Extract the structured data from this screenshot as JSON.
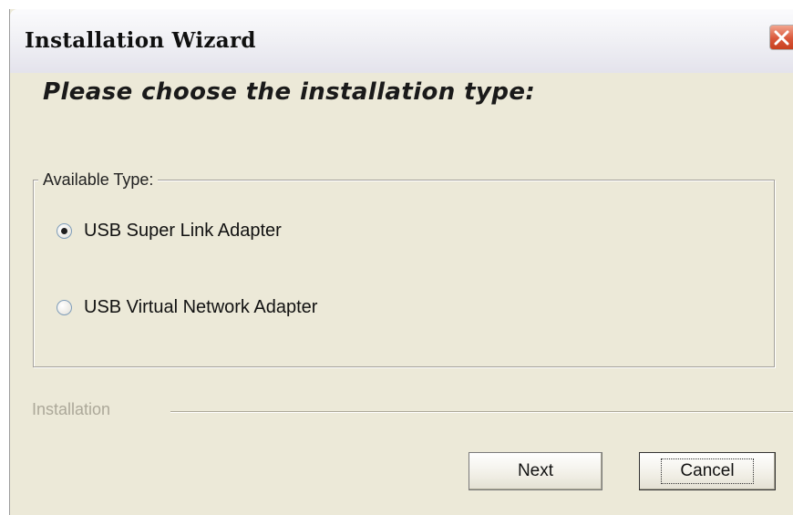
{
  "window": {
    "title": "Installation   Wizard",
    "close_icon": "close-x-icon"
  },
  "main": {
    "heading": "Please choose the installation type:"
  },
  "group": {
    "legend": "Available Type:",
    "options": [
      {
        "label": "USB Super Link Adapter",
        "selected": true
      },
      {
        "label": "USB Virtual Network Adapter",
        "selected": false
      }
    ]
  },
  "footer": {
    "section_label": "Installation",
    "next_label": "Next",
    "cancel_label": "Cancel"
  },
  "colors": {
    "window_bg": "#ece9d8",
    "close_button": "#d9573a",
    "disabled_text": "#aca899"
  }
}
